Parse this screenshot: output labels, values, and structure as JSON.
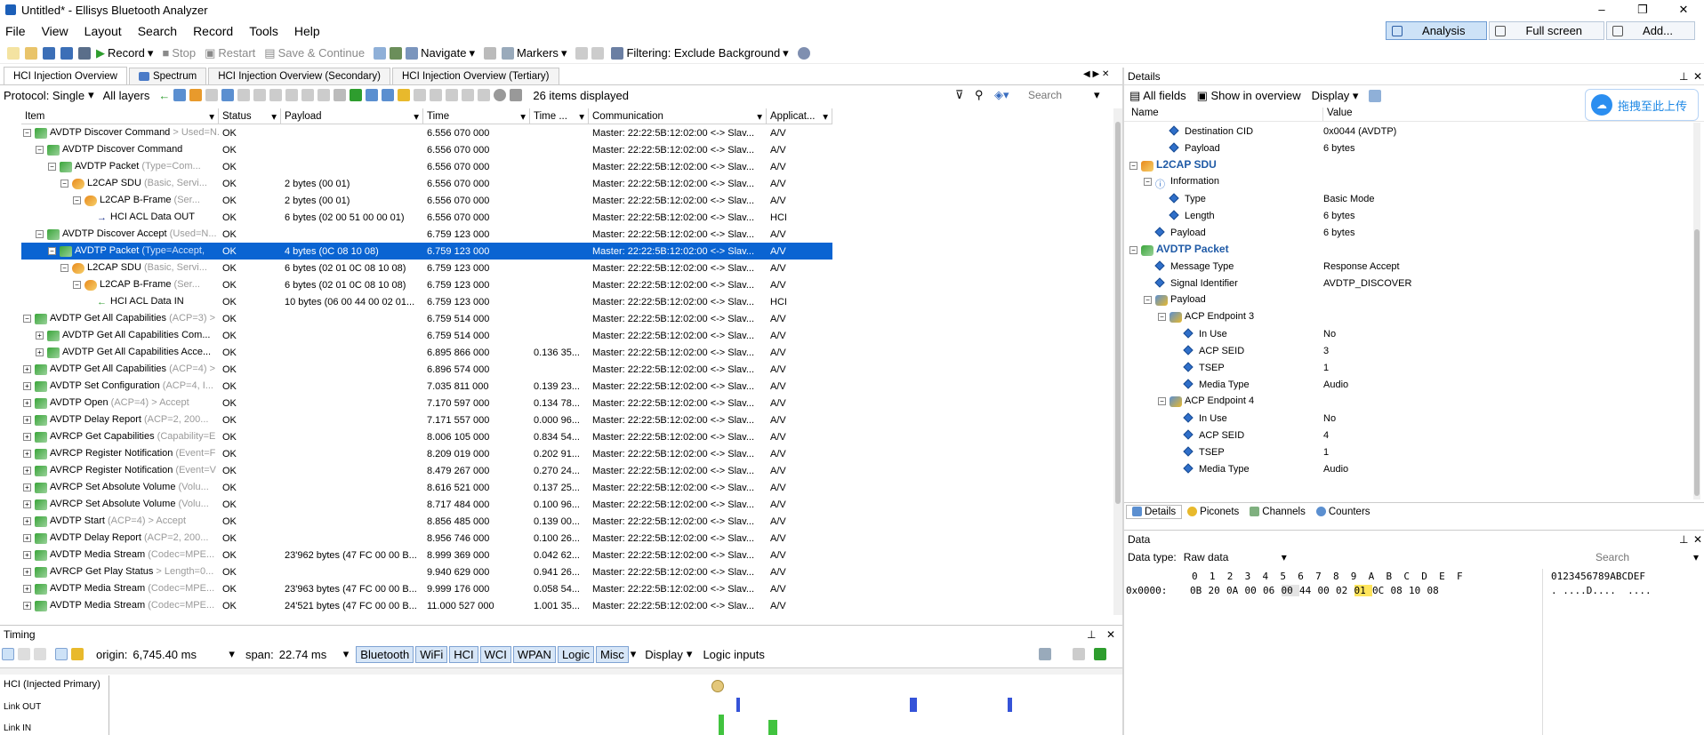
{
  "window": {
    "title": "Untitled* - Ellisys Bluetooth Analyzer",
    "controls": [
      "–",
      "❐",
      "✕"
    ]
  },
  "menu": {
    "items": [
      "File",
      "View",
      "Layout",
      "Search",
      "Record",
      "Tools",
      "Help"
    ],
    "view_buttons": [
      "Analysis",
      "Full screen",
      "Add..."
    ]
  },
  "toolbar": {
    "record": "Record",
    "stop": "Stop",
    "restart": "Restart",
    "save_continue": "Save & Continue",
    "navigate": "Navigate",
    "markers": "Markers",
    "filtering": "Filtering: Exclude Background"
  },
  "tabs": [
    "HCI Injection Overview",
    "Spectrum",
    "HCI Injection Overview (Secondary)",
    "HCI Injection Overview (Tertiary)"
  ],
  "filterbar": {
    "protocol": "Protocol: Single",
    "layers": "All layers",
    "count": "26 items displayed",
    "search_placeholder": "Search"
  },
  "grid": {
    "columns": [
      "Item",
      "Status",
      "Payload",
      "Time",
      "Time ...",
      "Communication",
      "Applicat..."
    ],
    "rows": [
      {
        "indent": 0,
        "tree": "⊟",
        "icon": "green",
        "item": "AVDTP Discover Command",
        "meta": " > Used=N...",
        "status": "OK",
        "payload": "",
        "time": "6.556 070 000",
        "delta": "",
        "comm": "Master: 22:22:5B:12:02:00 <-> Slav...",
        "app": "A/V"
      },
      {
        "indent": 1,
        "tree": "⊟",
        "icon": "green",
        "item": "AVDTP Discover Command",
        "meta": "",
        "status": "OK",
        "payload": "",
        "time": "6.556 070 000",
        "delta": "",
        "comm": "Master: 22:22:5B:12:02:00 <-> Slav...",
        "app": "A/V"
      },
      {
        "indent": 2,
        "tree": "⊟",
        "icon": "green",
        "item": "AVDTP Packet",
        "meta": " (Type=Com...",
        "status": "OK",
        "payload": "",
        "time": "6.556 070 000",
        "delta": "",
        "comm": "Master: 22:22:5B:12:02:00 <-> Slav...",
        "app": "A/V"
      },
      {
        "indent": 3,
        "tree": "⊟",
        "icon": "orange",
        "item": "L2CAP SDU",
        "meta": " (Basic, Servi...",
        "status": "OK",
        "payload": "2 bytes (00 01)",
        "time": "6.556 070 000",
        "delta": "",
        "comm": "Master: 22:22:5B:12:02:00 <-> Slav...",
        "app": "A/V"
      },
      {
        "indent": 4,
        "tree": "⊟",
        "icon": "orange",
        "item": "L2CAP B-Frame",
        "meta": " (Ser...",
        "status": "OK",
        "payload": "2 bytes (00 01)",
        "time": "6.556 070 000",
        "delta": "",
        "comm": "Master: 22:22:5B:12:02:00 <-> Slav...",
        "app": "A/V"
      },
      {
        "indent": 5,
        "tree": "",
        "icon": "arrow-right",
        "item": "HCI ACL Data OUT",
        "meta": "",
        "status": "OK",
        "payload": "6 bytes (02 00 51 00 00 01)",
        "time": "6.556 070 000",
        "delta": "",
        "comm": "Master: 22:22:5B:12:02:00 <-> Slav...",
        "app": "HCI"
      },
      {
        "indent": 1,
        "tree": "⊟",
        "icon": "green",
        "item": "AVDTP Discover Accept",
        "meta": " (Used=N...",
        "status": "OK",
        "payload": "",
        "time": "6.759 123 000",
        "delta": "",
        "comm": "Master: 22:22:5B:12:02:00 <-> Slav...",
        "app": "A/V"
      },
      {
        "indent": 2,
        "tree": "⊟",
        "icon": "green",
        "item": "AVDTP Packet",
        "meta": " (Type=Accept,",
        "status": "OK",
        "payload": "4 bytes (0C 08 10 08)",
        "time": "6.759 123 000",
        "delta": "",
        "comm": "Master: 22:22:5B:12:02:00 <-> Slav...",
        "app": "A/V",
        "sel": true
      },
      {
        "indent": 3,
        "tree": "⊟",
        "icon": "orange",
        "item": "L2CAP SDU",
        "meta": " (Basic, Servi...",
        "status": "OK",
        "payload": "6 bytes (02 01 0C 08 10 08)",
        "time": "6.759 123 000",
        "delta": "",
        "comm": "Master: 22:22:5B:12:02:00 <-> Slav...",
        "app": "A/V"
      },
      {
        "indent": 4,
        "tree": "⊟",
        "icon": "orange",
        "item": "L2CAP B-Frame",
        "meta": " (Ser...",
        "status": "OK",
        "payload": "6 bytes (02 01 0C 08 10 08)",
        "time": "6.759 123 000",
        "delta": "",
        "comm": "Master: 22:22:5B:12:02:00 <-> Slav...",
        "app": "A/V"
      },
      {
        "indent": 5,
        "tree": "",
        "icon": "arrow-left",
        "item": "HCI ACL Data IN",
        "meta": "",
        "status": "OK",
        "payload": "10 bytes (06 00 44 00 02 01...",
        "time": "6.759 123 000",
        "delta": "",
        "comm": "Master: 22:22:5B:12:02:00 <-> Slav...",
        "app": "HCI"
      },
      {
        "indent": 0,
        "tree": "⊟",
        "icon": "green",
        "item": "AVDTP Get All Capabilities",
        "meta": " (ACP=3) >",
        "status": "OK",
        "payload": "",
        "time": "6.759 514 000",
        "delta": "",
        "comm": "Master: 22:22:5B:12:02:00 <-> Slav...",
        "app": "A/V"
      },
      {
        "indent": 1,
        "tree": "⊞",
        "icon": "green",
        "item": "AVDTP Get All Capabilities Com...",
        "meta": "",
        "status": "OK",
        "payload": "",
        "time": "6.759 514 000",
        "delta": "",
        "comm": "Master: 22:22:5B:12:02:00 <-> Slav...",
        "app": "A/V"
      },
      {
        "indent": 1,
        "tree": "⊞",
        "icon": "green",
        "item": "AVDTP Get All Capabilities Acce...",
        "meta": "",
        "status": "OK",
        "payload": "",
        "time": "6.895 866 000",
        "delta": "0.136 35...",
        "comm": "Master: 22:22:5B:12:02:00 <-> Slav...",
        "app": "A/V"
      },
      {
        "indent": 0,
        "tree": "⊞",
        "icon": "green",
        "item": "AVDTP Get All Capabilities",
        "meta": " (ACP=4) >",
        "status": "OK",
        "payload": "",
        "time": "6.896 574 000",
        "delta": "",
        "comm": "Master: 22:22:5B:12:02:00 <-> Slav...",
        "app": "A/V"
      },
      {
        "indent": 0,
        "tree": "⊞",
        "icon": "green",
        "item": "AVDTP Set Configuration",
        "meta": " (ACP=4, I...",
        "status": "OK",
        "payload": "",
        "time": "7.035 811 000",
        "delta": "0.139 23...",
        "comm": "Master: 22:22:5B:12:02:00 <-> Slav...",
        "app": "A/V"
      },
      {
        "indent": 0,
        "tree": "⊞",
        "icon": "green",
        "item": "AVDTP Open",
        "meta": " (ACP=4) > Accept",
        "status": "OK",
        "payload": "",
        "time": "7.170 597 000",
        "delta": "0.134 78...",
        "comm": "Master: 22:22:5B:12:02:00 <-> Slav...",
        "app": "A/V"
      },
      {
        "indent": 0,
        "tree": "⊞",
        "icon": "green",
        "item": "AVDTP Delay Report",
        "meta": " (ACP=2, 200...",
        "status": "OK",
        "payload": "",
        "time": "7.171 557 000",
        "delta": "0.000 96...",
        "comm": "Master: 22:22:5B:12:02:00 <-> Slav...",
        "app": "A/V"
      },
      {
        "indent": 0,
        "tree": "⊞",
        "icon": "green",
        "item": "AVRCP Get Capabilities",
        "meta": " (Capability=E",
        "status": "OK",
        "payload": "",
        "time": "8.006 105 000",
        "delta": "0.834 54...",
        "comm": "Master: 22:22:5B:12:02:00 <-> Slav...",
        "app": "A/V"
      },
      {
        "indent": 0,
        "tree": "⊞",
        "icon": "green",
        "item": "AVRCP Register Notification",
        "meta": " (Event=F",
        "status": "OK",
        "payload": "",
        "time": "8.209 019 000",
        "delta": "0.202 91...",
        "comm": "Master: 22:22:5B:12:02:00 <-> Slav...",
        "app": "A/V"
      },
      {
        "indent": 0,
        "tree": "⊞",
        "icon": "green",
        "item": "AVRCP Register Notification",
        "meta": " (Event=V",
        "status": "OK",
        "payload": "",
        "time": "8.479 267 000",
        "delta": "0.270 24...",
        "comm": "Master: 22:22:5B:12:02:00 <-> Slav...",
        "app": "A/V"
      },
      {
        "indent": 0,
        "tree": "⊞",
        "icon": "green",
        "item": "AVRCP Set Absolute Volume",
        "meta": " (Volu...",
        "status": "OK",
        "payload": "",
        "time": "8.616 521 000",
        "delta": "0.137 25...",
        "comm": "Master: 22:22:5B:12:02:00 <-> Slav...",
        "app": "A/V"
      },
      {
        "indent": 0,
        "tree": "⊞",
        "icon": "green",
        "item": "AVRCP Set Absolute Volume",
        "meta": " (Volu...",
        "status": "OK",
        "payload": "",
        "time": "8.717 484 000",
        "delta": "0.100 96...",
        "comm": "Master: 22:22:5B:12:02:00 <-> Slav...",
        "app": "A/V"
      },
      {
        "indent": 0,
        "tree": "⊞",
        "icon": "green",
        "item": "AVDTP Start",
        "meta": " (ACP=4) > Accept",
        "status": "OK",
        "payload": "",
        "time": "8.856 485 000",
        "delta": "0.139 00...",
        "comm": "Master: 22:22:5B:12:02:00 <-> Slav...",
        "app": "A/V"
      },
      {
        "indent": 0,
        "tree": "⊞",
        "icon": "green",
        "item": "AVDTP Delay Report",
        "meta": " (ACP=2, 200...",
        "status": "OK",
        "payload": "",
        "time": "8.956 746 000",
        "delta": "0.100 26...",
        "comm": "Master: 22:22:5B:12:02:00 <-> Slav...",
        "app": "A/V"
      },
      {
        "indent": 0,
        "tree": "⊞",
        "icon": "green",
        "item": "AVDTP Media Stream",
        "meta": " (Codec=MPE...",
        "status": "OK",
        "payload": "23'962 bytes (47 FC 00 00 B...",
        "time": "8.999 369 000",
        "delta": "0.042 62...",
        "comm": "Master: 22:22:5B:12:02:00 <-> Slav...",
        "app": "A/V"
      },
      {
        "indent": 0,
        "tree": "⊞",
        "icon": "green",
        "item": "AVRCP Get Play Status",
        "meta": " > Length=0...",
        "status": "OK",
        "payload": "",
        "time": "9.940 629 000",
        "delta": "0.941 26...",
        "comm": "Master: 22:22:5B:12:02:00 <-> Slav...",
        "app": "A/V"
      },
      {
        "indent": 0,
        "tree": "⊞",
        "icon": "green",
        "item": "AVDTP Media Stream",
        "meta": " (Codec=MPE...",
        "status": "OK",
        "payload": "23'963 bytes (47 FC 00 00 B...",
        "time": "9.999 176 000",
        "delta": "0.058 54...",
        "comm": "Master: 22:22:5B:12:02:00 <-> Slav...",
        "app": "A/V"
      },
      {
        "indent": 0,
        "tree": "⊞",
        "icon": "green",
        "item": "AVDTP Media Stream",
        "meta": " (Codec=MPE...",
        "status": "OK",
        "payload": "24'521 bytes (47 FC 00 00 B...",
        "time": "11.000 527 000",
        "delta": "1.001 35...",
        "comm": "Master: 22:22:5B:12:02:00 <-> Slav...",
        "app": "A/V"
      }
    ]
  },
  "timing": {
    "title": "Timing",
    "origin_label": "origin:",
    "origin": "6,745.40 ms",
    "span_label": "span:",
    "span": "22.74 ms",
    "chips": [
      "Bluetooth",
      "WiFi",
      "HCI",
      "WCI",
      "WPAN",
      "Logic",
      "Misc"
    ],
    "display": "Display",
    "logic_inputs": "Logic inputs",
    "lanes": [
      "HCI (Injected Primary)",
      "Link OUT",
      "Link IN"
    ]
  },
  "details": {
    "title": "Details",
    "all_fields": "All fields",
    "show_overview": "Show in overview",
    "display": "Display",
    "col_name": "Name",
    "col_value": "Value",
    "rows": [
      {
        "indent": 2,
        "kind": "field",
        "name": "Destination CID",
        "value": "0x0044 (AVDTP)"
      },
      {
        "indent": 2,
        "kind": "field",
        "name": "Payload",
        "value": "6 bytes"
      },
      {
        "indent": 0,
        "kind": "head",
        "name": "L2CAP SDU",
        "value": ""
      },
      {
        "indent": 1,
        "kind": "group",
        "name": "Information",
        "value": ""
      },
      {
        "indent": 2,
        "kind": "field",
        "name": "Type",
        "value": "Basic Mode"
      },
      {
        "indent": 2,
        "kind": "field",
        "name": "Length",
        "value": "6 bytes"
      },
      {
        "indent": 1,
        "kind": "field",
        "name": "Payload",
        "value": "6 bytes"
      },
      {
        "indent": 0,
        "kind": "head",
        "name": "AVDTP Packet",
        "value": ""
      },
      {
        "indent": 1,
        "kind": "field",
        "name": "Message Type",
        "value": "Response Accept"
      },
      {
        "indent": 1,
        "kind": "field",
        "name": "Signal Identifier",
        "value": "AVDTP_DISCOVER"
      },
      {
        "indent": 1,
        "kind": "group",
        "name": "Payload",
        "value": ""
      },
      {
        "indent": 2,
        "kind": "group",
        "name": "ACP Endpoint 3",
        "value": ""
      },
      {
        "indent": 3,
        "kind": "field",
        "name": "In Use",
        "value": "No"
      },
      {
        "indent": 3,
        "kind": "field",
        "name": "ACP SEID",
        "value": "3"
      },
      {
        "indent": 3,
        "kind": "field",
        "name": "TSEP",
        "value": "1"
      },
      {
        "indent": 3,
        "kind": "field",
        "name": "Media Type",
        "value": "Audio"
      },
      {
        "indent": 2,
        "kind": "group",
        "name": "ACP Endpoint 4",
        "value": ""
      },
      {
        "indent": 3,
        "kind": "field",
        "name": "In Use",
        "value": "No"
      },
      {
        "indent": 3,
        "kind": "field",
        "name": "ACP SEID",
        "value": "4"
      },
      {
        "indent": 3,
        "kind": "field",
        "name": "TSEP",
        "value": "1"
      },
      {
        "indent": 3,
        "kind": "field",
        "name": "Media Type",
        "value": "Audio"
      }
    ],
    "bottom_tabs": [
      "Details",
      "Piconets",
      "Channels",
      "Counters"
    ]
  },
  "data_panel": {
    "title": "Data",
    "type_label": "Data type:",
    "type_value": "Raw data",
    "search_placeholder": "Search",
    "hex_header": "0  1  2  3  4  5  6  7  8  9  A  B  C  D  E  F",
    "ascii_header": "0123456789ABCDEF",
    "offset": "0x0000:",
    "bytes": [
      "0B",
      "20",
      "0A",
      "00",
      "06",
      "00",
      "44",
      "00",
      "02",
      "01",
      "0C",
      "08",
      "10",
      "08"
    ],
    "ascii": ". ....D....  ...."
  },
  "overlay": {
    "cloud_label": "拖拽至此上传"
  },
  "colors": {
    "selection": "#0a64d2",
    "accent": "#1f5aa6",
    "ok_green": "#2e9d2e"
  }
}
